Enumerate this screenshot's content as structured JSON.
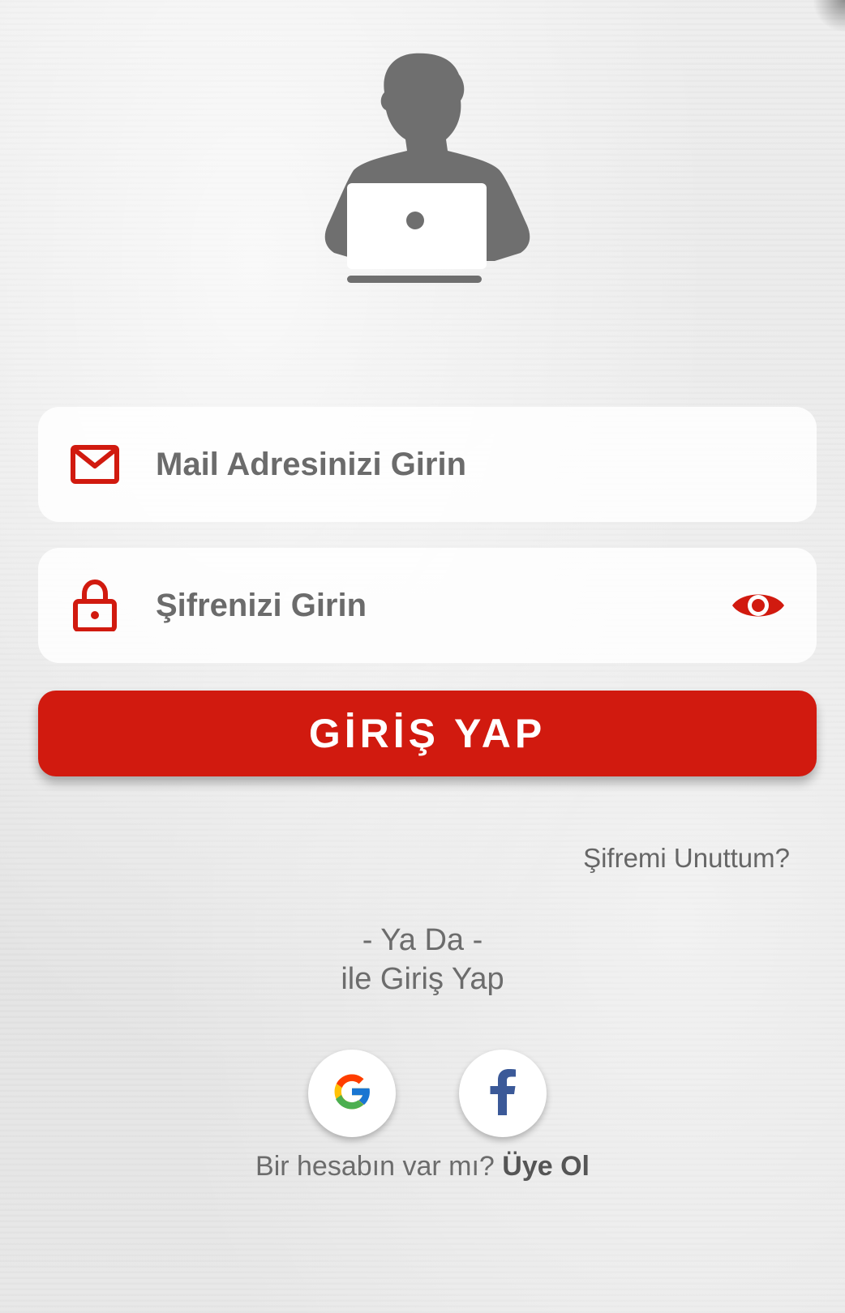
{
  "avatar": {
    "icon": "person-with-laptop-icon",
    "color": "#6f6f6f"
  },
  "email_field": {
    "placeholder": "Mail Adresinizi Girin",
    "value": "",
    "icon": "mail-icon"
  },
  "password_field": {
    "placeholder": "Şifrenizi Girin",
    "value": "",
    "icon": "lock-icon",
    "toggle_icon": "eye-icon"
  },
  "login_button": {
    "label": "GİRİŞ YAP"
  },
  "forgot_password": {
    "label": "Şifremi Unuttum?"
  },
  "divider": {
    "line1": "- Ya Da -",
    "line2": "ile Giriş Yap"
  },
  "social": {
    "google_icon": "google-icon",
    "facebook_icon": "facebook-icon"
  },
  "signup": {
    "prompt": "Bir hesabın var mı?",
    "link": "Üye Ol"
  },
  "colors": {
    "accent": "#d11a0f",
    "icon_red": "#d11a0f",
    "text_gray": "#6c6c6c",
    "facebook_blue": "#3b5998"
  }
}
